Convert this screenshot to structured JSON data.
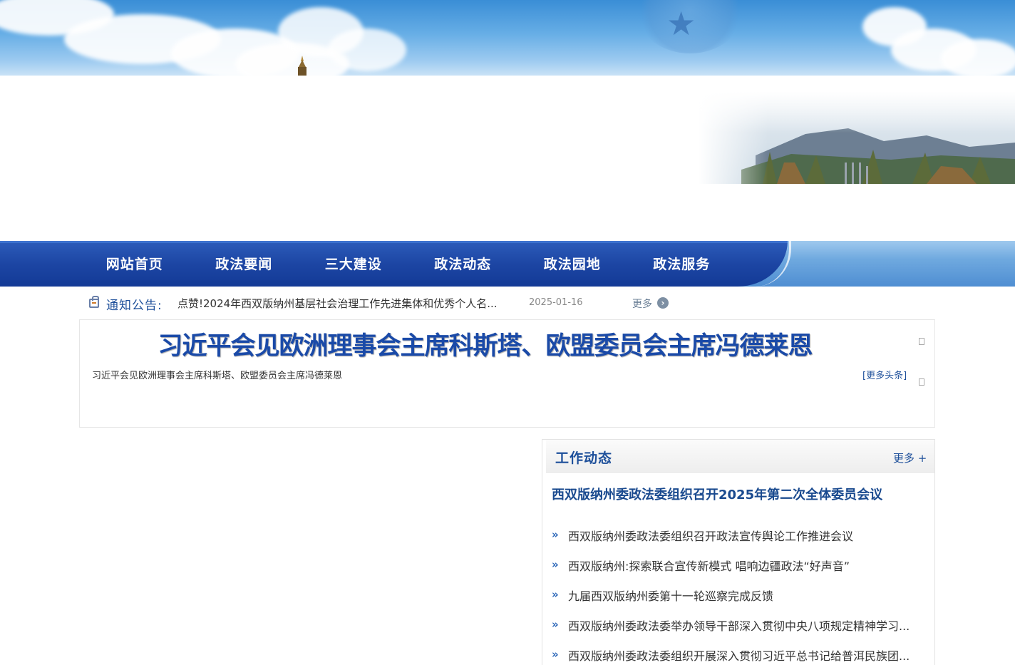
{
  "nav": {
    "items": [
      {
        "label": "网站首页"
      },
      {
        "label": "政法要闻"
      },
      {
        "label": "三大建设"
      },
      {
        "label": "政法动态"
      },
      {
        "label": "政法园地"
      },
      {
        "label": "政法服务"
      }
    ]
  },
  "notice": {
    "label": "通知公告:",
    "text": "点赞!2024年西双版纳州基层社会治理工作先进集体和优秀个人名...",
    "date": "2025-01-16",
    "more_label": "更多",
    "more_icon": "chevron-right-circle-icon"
  },
  "headline": {
    "title": "习近平会见欧洲理事会主席科斯塔、欧盟委员会主席冯德莱恩",
    "subtitle": "习近平会见欧洲理事会主席科斯塔、欧盟委员会主席冯德莱恩",
    "more_label": "[更多头条]"
  },
  "work": {
    "title": "工作动态",
    "more_label": "更多 +",
    "lead": "西双版纳州委政法委组织召开2025年第二次全体委员会议",
    "bullet": "»",
    "items": [
      {
        "text": "西双版纳州委政法委组织召开政法宣传舆论工作推进会议"
      },
      {
        "text": "西双版纳州:探索联合宣传新模式 唱响边疆政法“好声音”"
      },
      {
        "text": "九届西双版纳州委第十一轮巡察完成反馈"
      },
      {
        "text": "西双版纳州委政法委举办领导干部深入贯彻中央八项规定精神学习..."
      },
      {
        "text": "西双版纳州委政法委组织开展深入贯彻习近平总书记给普洱民族团..."
      }
    ]
  },
  "colors": {
    "nav_blue": "#1c45a3",
    "title_blue": "#1a4aa8",
    "link_blue": "#1d4f9a"
  }
}
